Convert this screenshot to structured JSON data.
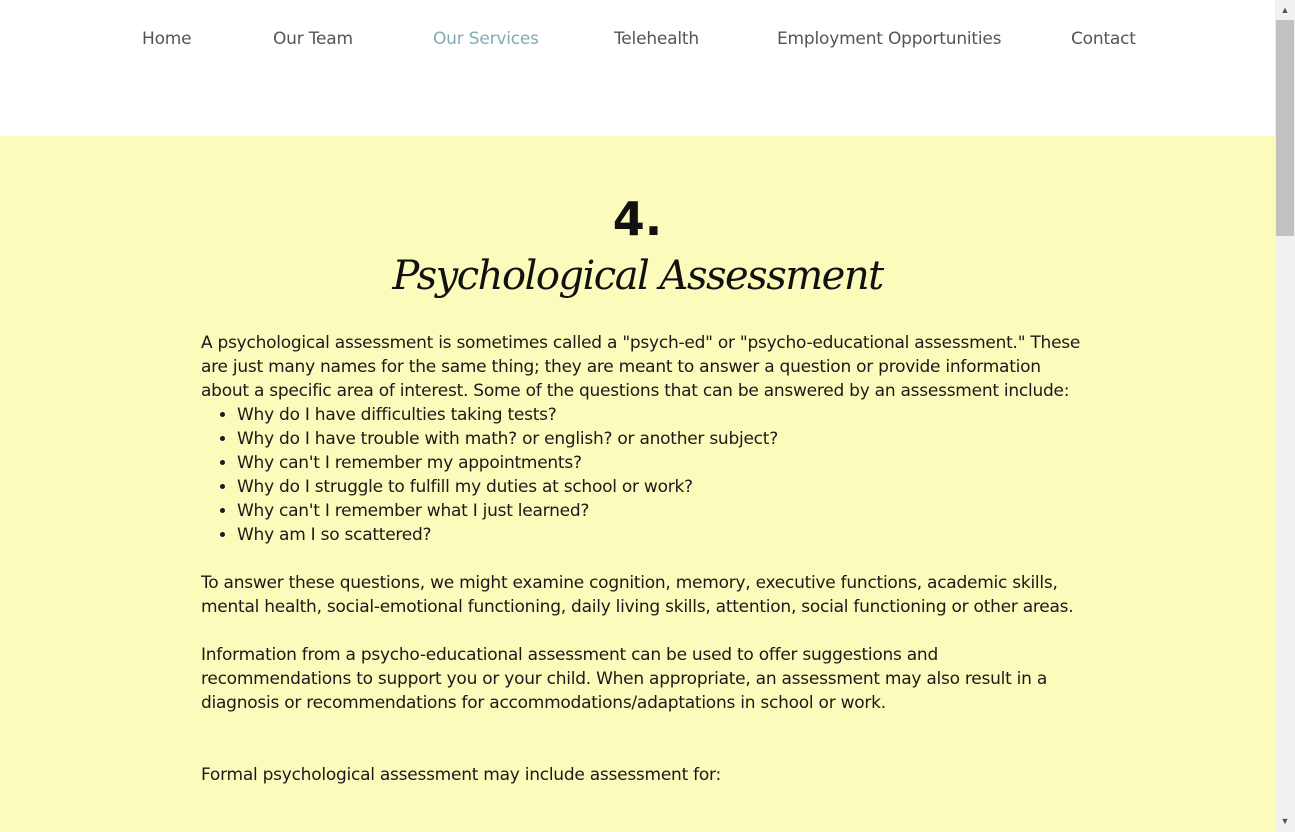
{
  "nav": {
    "items": [
      {
        "label": "Home"
      },
      {
        "label": "Our Team"
      },
      {
        "label": "Our Services"
      },
      {
        "label": "Telehealth"
      },
      {
        "label": "Employment Opportunities"
      },
      {
        "label": "Contact"
      }
    ],
    "active": "Our Services"
  },
  "section": {
    "number": "4.",
    "title": "Psychological Assessment",
    "intro": "A psychological assessment is sometimes called a \"psych-ed\" or \"psycho-educational assessment.\" These are just many names for the same thing;  they are meant to answer a question or provide information about a specific area of interest. Some of the questions that can be answered by an assessment include:",
    "questions": [
      "Why do I have difficulties taking tests?",
      "Why do I have trouble with math? or english? or another subject?",
      "Why can't I remember my appointments?",
      "Why do I struggle to fulfill my duties at school or work?",
      "Why can't I remember what I just learned?",
      "Why am I so scattered?"
    ],
    "paragraph2": "To answer these questions, we might examine cognition, memory, executive functions, academic skills, mental health, social-emotional functioning, daily living skills, attention, social functioning or other areas.",
    "paragraph3": "Information from a psycho-educational assessment can be used to offer suggestions and recommendations to support you or your child. When appropriate, an assessment may also result in a diagnosis or recommendations for accommodations/adaptations in school or work.",
    "paragraph4": "Formal psychological assessment may include assessment for:"
  },
  "colors": {
    "section_bg": "#fbfbbb",
    "nav_text": "#555555",
    "nav_active": "#7fadb3"
  }
}
